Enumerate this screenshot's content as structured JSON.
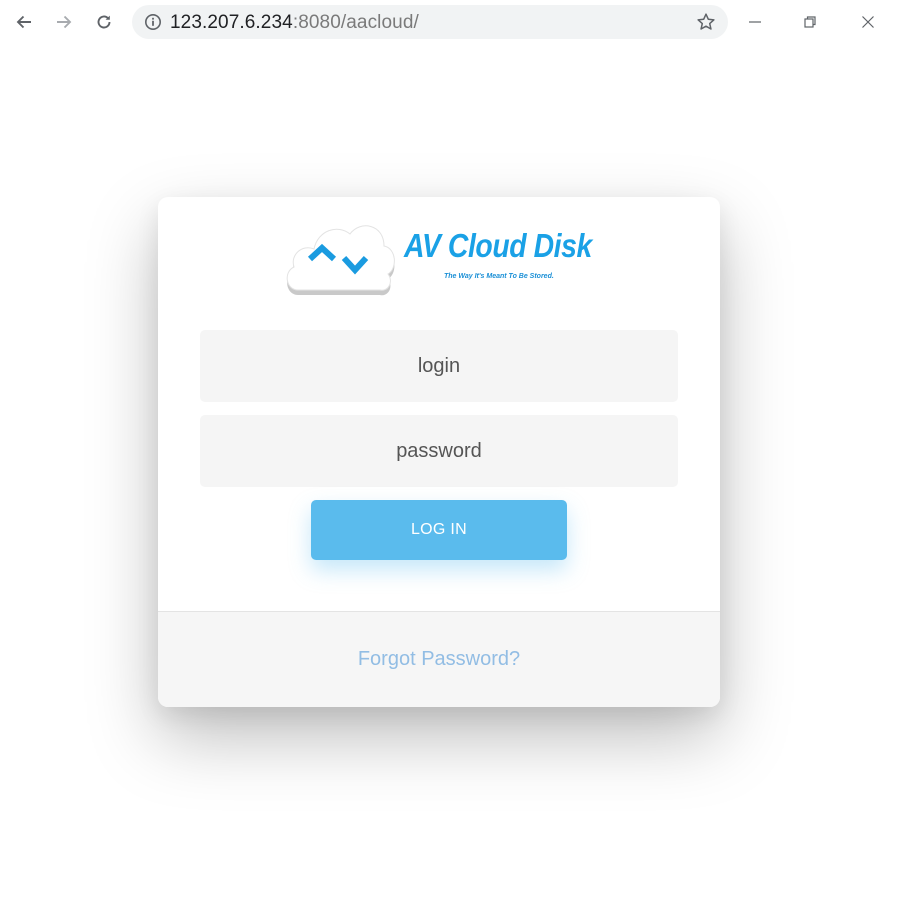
{
  "browser": {
    "address_host": "123.207.6.234",
    "address_rest": ":8080/aacloud/",
    "icons": [
      "back-arrow-icon",
      "forward-arrow-icon",
      "reload-icon",
      "info-icon",
      "star-icon",
      "minimize-icon",
      "restore-icon",
      "close-icon"
    ]
  },
  "logo": {
    "title": "AV Cloud Disk",
    "tagline": "The Way It's Meant To Be Stored."
  },
  "form": {
    "login_placeholder": "login",
    "password_placeholder": "password",
    "submit_label": "LOG IN",
    "forgot_label": "Forgot Password?"
  },
  "colors": {
    "brand_blue": "#1aa1e6",
    "button_blue": "#5abbed",
    "link_blue": "#92bde4",
    "field_bg": "#f5f5f5"
  }
}
